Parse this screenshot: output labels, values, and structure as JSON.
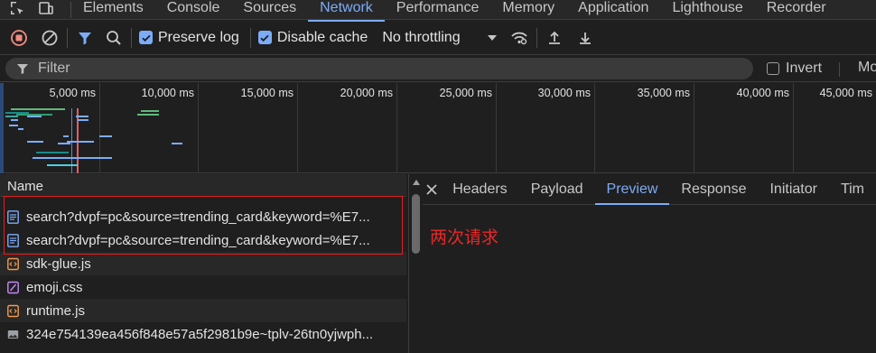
{
  "tabbar": {
    "tabs": [
      {
        "label": "Elements",
        "active": false
      },
      {
        "label": "Console",
        "active": false
      },
      {
        "label": "Sources",
        "active": false
      },
      {
        "label": "Network",
        "active": true
      },
      {
        "label": "Performance",
        "active": false
      },
      {
        "label": "Memory",
        "active": false
      },
      {
        "label": "Application",
        "active": false
      },
      {
        "label": "Lighthouse",
        "active": false
      },
      {
        "label": "Recorder",
        "active": false
      }
    ]
  },
  "toolbar": {
    "preserve_log_label": "Preserve log",
    "preserve_log_checked": true,
    "disable_cache_label": "Disable cache",
    "disable_cache_checked": true,
    "throttling_value": "No throttling"
  },
  "filter": {
    "placeholder": "Filter",
    "invert_label": "Invert",
    "invert_checked": false,
    "more_label": "Mo"
  },
  "timeline": {
    "ticks": [
      "5,000 ms",
      "10,000 ms",
      "15,000 ms",
      "20,000 ms",
      "25,000 ms",
      "30,000 ms",
      "35,000 ms",
      "40,000 ms",
      "45,000 ms"
    ]
  },
  "requests": {
    "column_name": "Name",
    "rows": [
      {
        "name": "search?dvpf=pc&source=trending_card&keyword=%E7...",
        "type": "document"
      },
      {
        "name": "search?dvpf=pc&source=trending_card&keyword=%E7...",
        "type": "document"
      },
      {
        "name": "sdk-glue.js",
        "type": "script"
      },
      {
        "name": "emoji.css",
        "type": "stylesheet"
      },
      {
        "name": "runtime.js",
        "type": "script"
      },
      {
        "name": "324e754139ea456f848e57a5f2981b9e~tplv-26tn0yjwph...",
        "type": "image"
      }
    ]
  },
  "detail": {
    "tabs": [
      {
        "label": "Headers",
        "active": false
      },
      {
        "label": "Payload",
        "active": false
      },
      {
        "label": "Preview",
        "active": true
      },
      {
        "label": "Response",
        "active": false
      },
      {
        "label": "Initiator",
        "active": false
      },
      {
        "label": "Tim",
        "active": false
      }
    ],
    "annotation": "两次请求"
  },
  "colors": {
    "accent": "#7cacf8",
    "record_red": "#f28b82",
    "annotation_red": "#e82828",
    "bg": "#1f1f1f"
  }
}
